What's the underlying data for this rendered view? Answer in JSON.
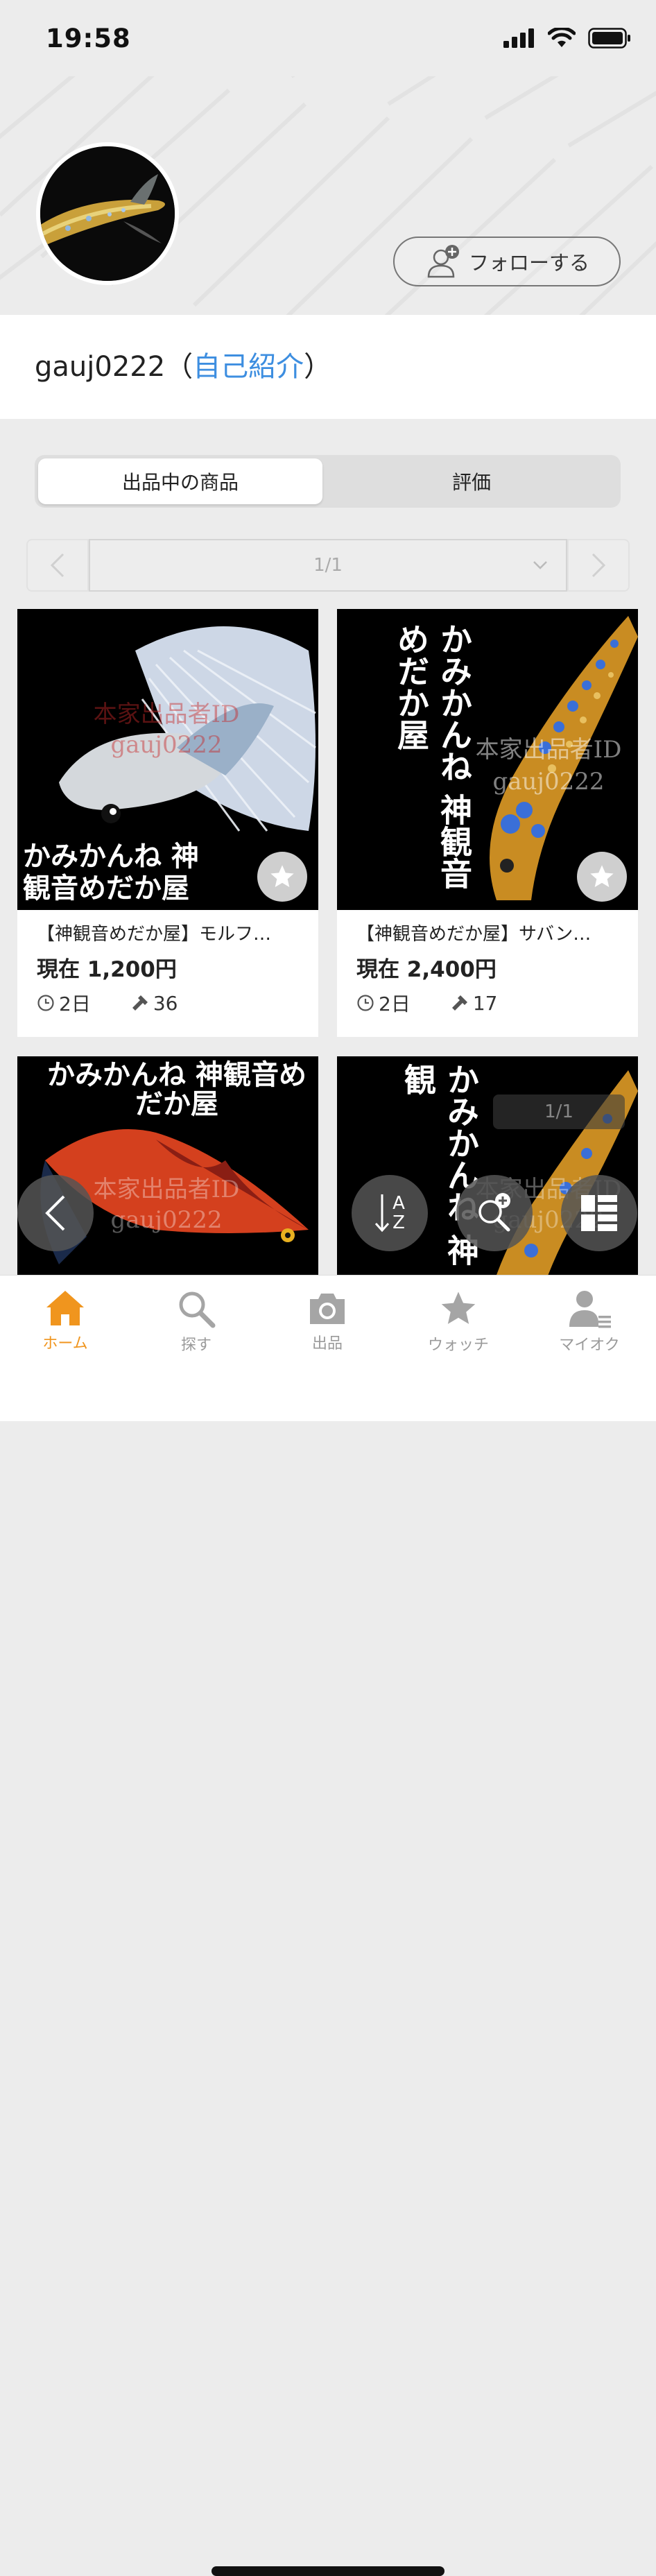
{
  "status": {
    "time": "19:58"
  },
  "profile": {
    "follow_label": "フォローする",
    "username": "gauj0222",
    "paren_open": "（",
    "intro_link": "自己紹介",
    "paren_close": "）"
  },
  "tabs": [
    {
      "label": "出品中の商品",
      "active": true
    },
    {
      "label": "評価",
      "active": false
    }
  ],
  "pager": {
    "value": "1/1"
  },
  "items": [
    {
      "title": "【神観音めだか屋】モルフ…",
      "price": "現在 1,200円",
      "time_left": "2日",
      "bids": "36",
      "image_text": "かみかんね 神観音めだか屋",
      "watermark": "本家出品者ID gauj0222"
    },
    {
      "title": "【神観音めだか屋】サバン…",
      "price": "現在 2,400円",
      "time_left": "2日",
      "bids": "17",
      "image_text": "かみかんね 神観音めだか屋",
      "watermark": "本家出品者ID gauj0222"
    },
    {
      "title": "",
      "price": "",
      "time_left": "",
      "bids": "",
      "image_text": "かみかんね 神観音めだか屋",
      "watermark": "本家出品者ID gauj0222"
    },
    {
      "title": "",
      "price": "",
      "time_left": "",
      "bids": "",
      "image_text": "かみかんね 神観",
      "watermark": "本家出品者ID gauj0222",
      "overlay_badge": "1/1"
    }
  ],
  "fabs": {
    "back": "chevron-left-icon",
    "sort_label_top": "A",
    "sort_label_bottom": "Z",
    "search_add": "search-plus-icon",
    "grid": "grid-view-icon"
  },
  "tabbar": [
    {
      "label": "ホーム",
      "icon": "home-icon",
      "active": true
    },
    {
      "label": "探す",
      "icon": "search-icon",
      "active": false
    },
    {
      "label": "出品",
      "icon": "camera-icon",
      "active": false
    },
    {
      "label": "ウォッチ",
      "icon": "star-icon",
      "active": false
    },
    {
      "label": "マイオク",
      "icon": "user-icon",
      "active": false
    }
  ],
  "colors": {
    "accent": "#f0951e",
    "link": "#3d8ee0",
    "tab_inactive": "#9a9a9a"
  }
}
